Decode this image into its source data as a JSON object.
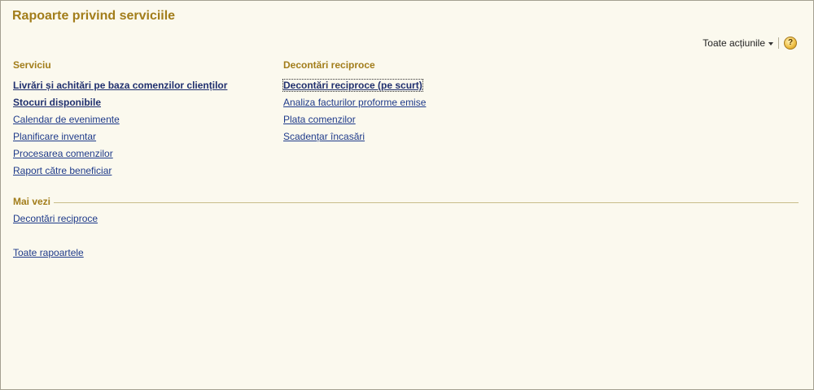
{
  "page": {
    "title": "Rapoarte privind serviciile"
  },
  "toolbar": {
    "all_actions": "Toate acțiunile",
    "help_symbol": "?"
  },
  "columns": {
    "service": {
      "heading": "Serviciu",
      "items": [
        {
          "label": "Livrări și achitări pe baza comenzilor clienților",
          "bold": true
        },
        {
          "label": "Stocuri disponibile",
          "bold": true
        },
        {
          "label": "Calendar de evenimente",
          "bold": false
        },
        {
          "label": "Planificare inventar",
          "bold": false
        },
        {
          "label": "Procesarea comenzilor",
          "bold": false
        },
        {
          "label": "Raport către beneficiar",
          "bold": false
        }
      ]
    },
    "settlements": {
      "heading": "Decontări reciproce",
      "items": [
        {
          "label": "Decontări reciproce (pe scurt)",
          "bold": true
        },
        {
          "label": "Analiza facturilor proforme emise",
          "bold": false
        },
        {
          "label": "Plata comenzilor",
          "bold": false
        },
        {
          "label": "Scadențar încasări",
          "bold": false
        }
      ]
    }
  },
  "see_also": {
    "heading": "Mai vezi",
    "items": [
      {
        "label": "Decontări reciproce"
      }
    ]
  },
  "footer": {
    "all_reports": "Toate rapoartele"
  },
  "colors": {
    "heading": "#a27d1a",
    "link": "#1e3a8a",
    "background": "#fbf9ee"
  }
}
